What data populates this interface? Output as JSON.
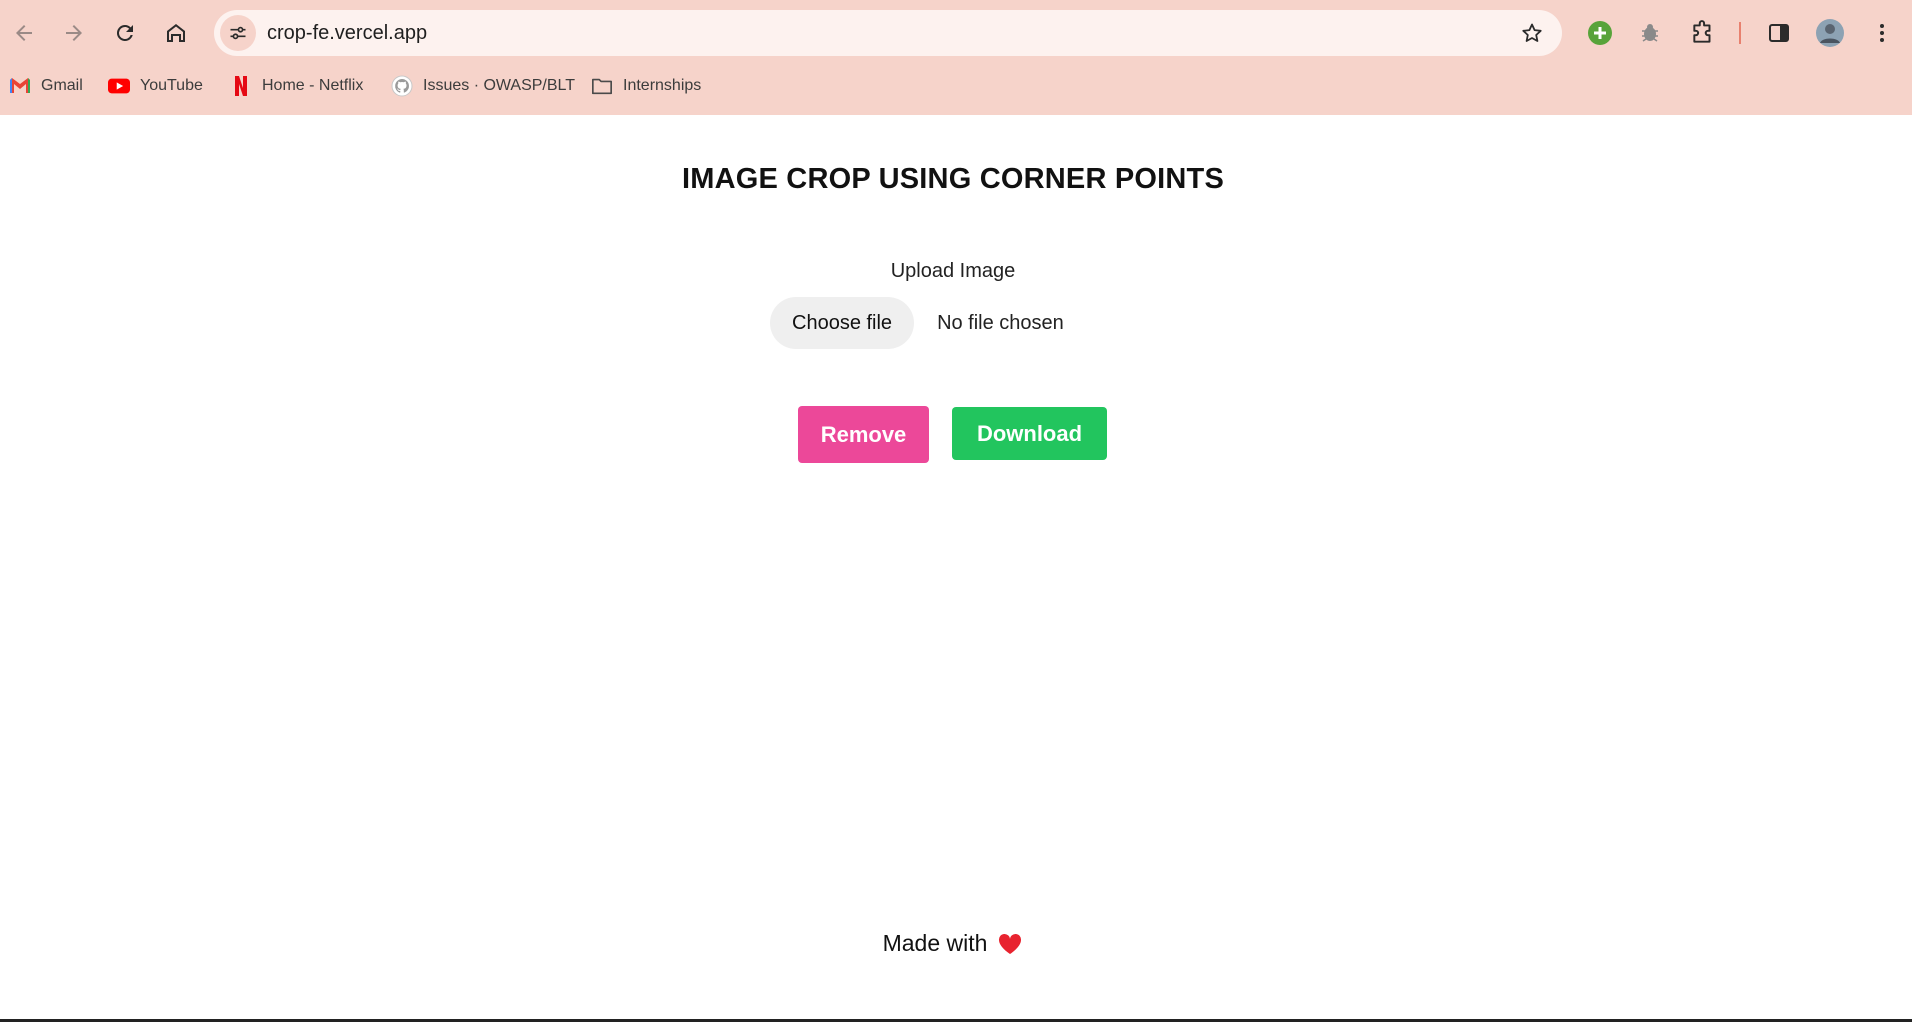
{
  "browser": {
    "url": "crop-fe.vercel.app",
    "bookmarks": [
      {
        "label": "Gmail",
        "icon": "gmail-icon"
      },
      {
        "label": "YouTube",
        "icon": "youtube-icon"
      },
      {
        "label": "Home - Netflix",
        "icon": "netflix-icon"
      },
      {
        "label": "Issues · OWASP/BLT",
        "icon": "github-icon"
      },
      {
        "label": "Internships",
        "icon": "folder-icon"
      }
    ],
    "colors": {
      "chrome": "#f6d3ca",
      "omnibox": "#fdf2ef"
    }
  },
  "page": {
    "title": "IMAGE CROP USING CORNER POINTS",
    "upload_label": "Upload Image",
    "choose_file_label": "Choose file",
    "file_status": "No file chosen",
    "remove_label": "Remove",
    "download_label": "Download",
    "footer_text": "Made with",
    "colors": {
      "remove": "#ec4899",
      "download": "#22c55e"
    }
  }
}
